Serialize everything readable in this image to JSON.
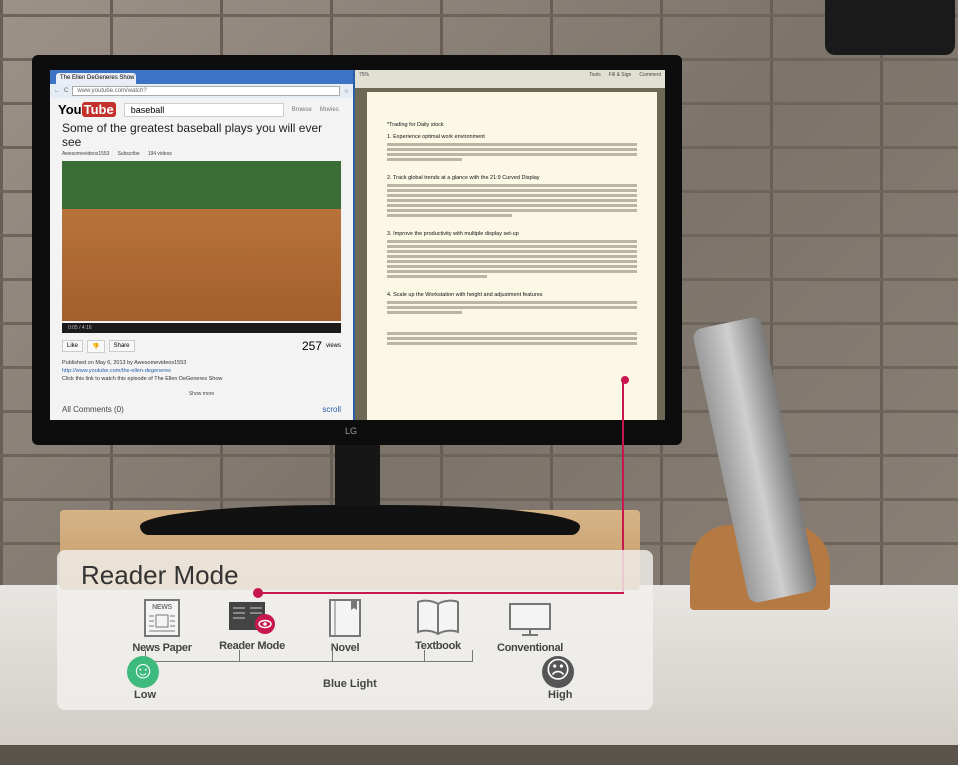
{
  "browser": {
    "tab_title": "The Ellen DeGeneres Show",
    "url": "www.youtube.com/watch?",
    "logo": "YouTube",
    "search_value": "baseball",
    "nav": [
      "Browse",
      "Movies"
    ],
    "video_title": "Some of the greatest baseball plays you will ever see",
    "channel": "Awesomevideos1553",
    "subscribe": "Subscribe",
    "videos_count": "194 videos",
    "time": "0:05 / 4:16",
    "like": "Like",
    "share": "Share",
    "views": "257",
    "views_label": "views",
    "published": "Published on May 6, 2013 by Awesomevideos1553",
    "link": "http://www.youtube.com/the-ellen-degeneres",
    "description": "Click this link to watch this episode of The Ellen DeGeneres Show",
    "show_more": "Show more",
    "comments": "All Comments (0)",
    "scroll_link": "scroll"
  },
  "pdf": {
    "toolbar_items": [
      "Tools",
      "Fill & Sign",
      "Comment"
    ],
    "zoom": "75%",
    "headings": [
      "*Trading for Daily stock",
      "1. Experience optimal work environment",
      "2. Track global trends at a glance with the 21:9 Curved Display",
      "3. Improve the productivity with multiple display set-up",
      "4. Scale up the Workstation with height and adjustment features"
    ]
  },
  "monitor": {
    "brand": "LG"
  },
  "overlay": {
    "title": "Reader Mode",
    "accent": "#c8174f",
    "modes": [
      {
        "label": "News Paper",
        "icon": "newspaper-icon"
      },
      {
        "label": "Reader Mode",
        "icon": "reader-mode-icon"
      },
      {
        "label": "Novel",
        "icon": "novel-icon"
      },
      {
        "label": "Textbook",
        "icon": "textbook-icon"
      },
      {
        "label": "Conventional",
        "icon": "monitor-icon"
      }
    ],
    "scale_label": "Blue Light",
    "low": "Low",
    "high": "High",
    "low_color": "#3dba7c",
    "high_color": "#555555"
  }
}
